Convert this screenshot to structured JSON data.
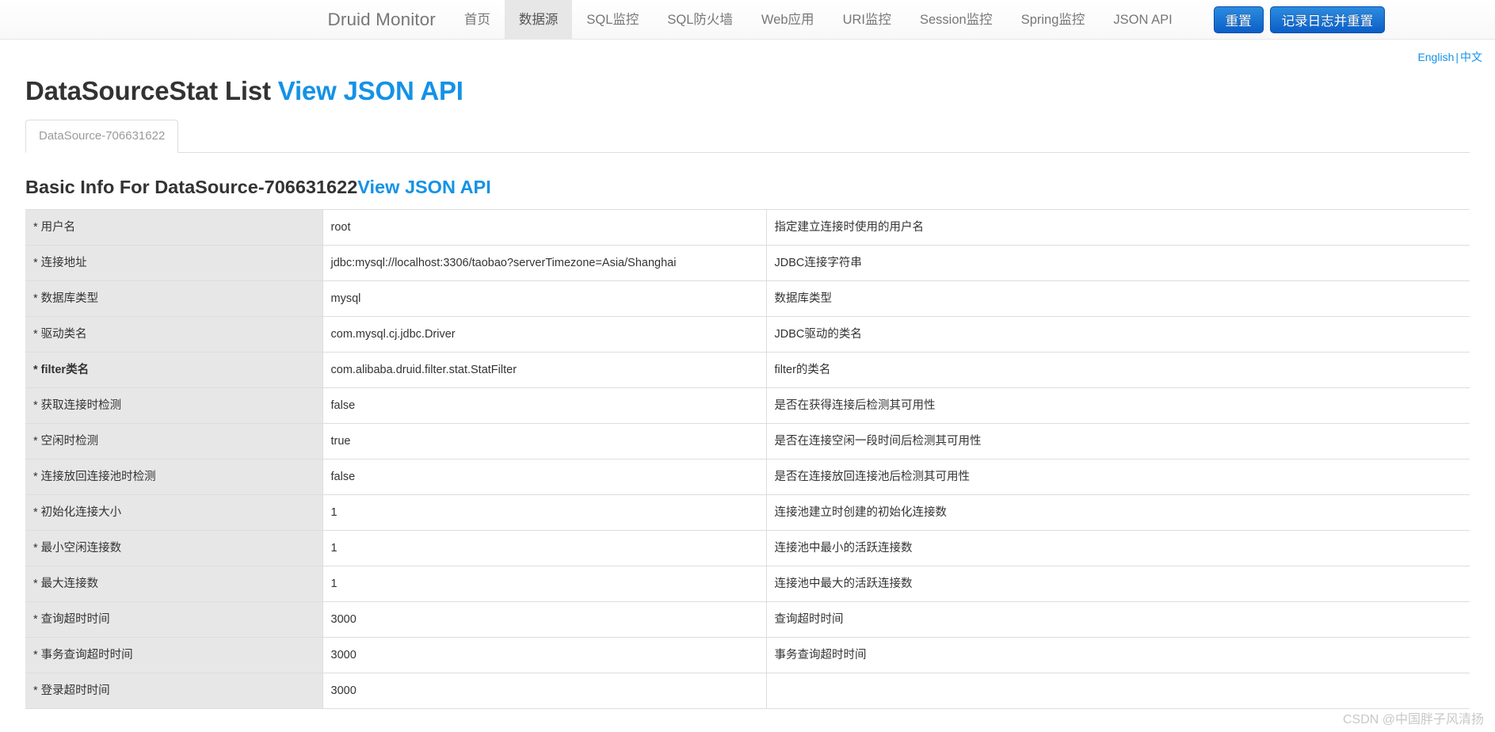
{
  "navbar": {
    "brand": "Druid Monitor",
    "links": [
      {
        "label": "首页",
        "active": false
      },
      {
        "label": "数据源",
        "active": true
      },
      {
        "label": "SQL监控",
        "active": false
      },
      {
        "label": "SQL防火墙",
        "active": false
      },
      {
        "label": "Web应用",
        "active": false
      },
      {
        "label": "URI监控",
        "active": false
      },
      {
        "label": "Session监控",
        "active": false
      },
      {
        "label": "Spring监控",
        "active": false
      },
      {
        "label": "JSON API",
        "active": false
      }
    ],
    "buttons": [
      {
        "label": "重置",
        "name": "reset-button"
      },
      {
        "label": "记录日志并重置",
        "name": "log-and-reset-button"
      }
    ],
    "accent_color": "#0b5ec7",
    "active_tab_bg": "#e7e7e7"
  },
  "lang": {
    "english": "English",
    "separator": "|",
    "chinese": "中文",
    "link_color": "#1492e6"
  },
  "page": {
    "title": "DataSourceStat List",
    "title_link": "View JSON API",
    "section_title": "Basic Info For DataSource-706631622",
    "section_link": "View JSON API"
  },
  "tabs": [
    {
      "label": "DataSource-706631622",
      "active": true
    }
  ],
  "table": {
    "rows": [
      {
        "key": "用户名",
        "required": true,
        "bold": false,
        "value": "root",
        "desc": "指定建立连接时使用的用户名"
      },
      {
        "key": "连接地址",
        "required": true,
        "bold": false,
        "value": "jdbc:mysql://localhost:3306/taobao?serverTimezone=Asia/Shanghai",
        "desc": "JDBC连接字符串"
      },
      {
        "key": "数据库类型",
        "required": true,
        "bold": false,
        "value": "mysql",
        "desc": "数据库类型"
      },
      {
        "key": "驱动类名",
        "required": true,
        "bold": false,
        "value": "com.mysql.cj.jdbc.Driver",
        "desc": "JDBC驱动的类名"
      },
      {
        "key": "filter类名",
        "required": true,
        "bold": true,
        "value": "com.alibaba.druid.filter.stat.StatFilter",
        "desc": "filter的类名"
      },
      {
        "key": "获取连接时检测",
        "required": true,
        "bold": false,
        "value": "false",
        "desc": "是否在获得连接后检测其可用性"
      },
      {
        "key": "空闲时检测",
        "required": true,
        "bold": false,
        "value": "true",
        "desc": "是否在连接空闲一段时间后检测其可用性"
      },
      {
        "key": "连接放回连接池时检测",
        "required": true,
        "bold": false,
        "value": "false",
        "desc": "是否在连接放回连接池后检测其可用性"
      },
      {
        "key": "初始化连接大小",
        "required": true,
        "bold": false,
        "value": "1",
        "desc": "连接池建立时创建的初始化连接数"
      },
      {
        "key": "最小空闲连接数",
        "required": true,
        "bold": false,
        "value": "1",
        "desc": "连接池中最小的活跃连接数"
      },
      {
        "key": "最大连接数",
        "required": true,
        "bold": false,
        "value": "1",
        "desc": "连接池中最大的活跃连接数"
      },
      {
        "key": "查询超时时间",
        "required": true,
        "bold": false,
        "value": "3000",
        "desc": "查询超时时间"
      },
      {
        "key": "事务查询超时时间",
        "required": true,
        "bold": false,
        "value": "3000",
        "desc": "事务查询超时时间"
      },
      {
        "key": "登录超时时间",
        "required": true,
        "bold": false,
        "value": "3000",
        "desc": ""
      }
    ]
  },
  "watermark": "CSDN @中国胖子风清扬"
}
